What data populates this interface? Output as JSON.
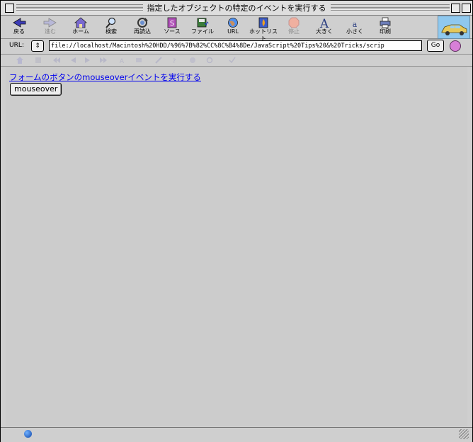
{
  "window": {
    "title": "指定したオブジェクトの特定のイベントを実行する"
  },
  "toolbar": {
    "items": [
      {
        "label": "戻る",
        "icon": "back-arrow-icon",
        "enabled": true
      },
      {
        "label": "進む",
        "icon": "forward-arrow-icon",
        "enabled": false
      },
      {
        "label": "ホーム",
        "icon": "home-icon",
        "enabled": true
      },
      {
        "label": "検索",
        "icon": "search-icon",
        "enabled": true
      },
      {
        "label": "再読込",
        "icon": "reload-icon",
        "enabled": true
      },
      {
        "label": "ソース",
        "icon": "source-icon",
        "enabled": true
      },
      {
        "label": "ファイル",
        "icon": "file-icon",
        "enabled": true
      },
      {
        "label": "URL",
        "icon": "globe-icon",
        "enabled": true
      },
      {
        "label": "ホットリスト",
        "icon": "hotlist-icon",
        "enabled": true
      },
      {
        "label": "停止",
        "icon": "stop-icon",
        "enabled": false
      },
      {
        "label": "大きく",
        "icon": "font-larger-icon",
        "enabled": true
      },
      {
        "label": "小さく",
        "icon": "font-smaller-icon",
        "enabled": true
      },
      {
        "label": "印刷",
        "icon": "print-icon",
        "enabled": true
      }
    ]
  },
  "urlbar": {
    "label": "URL:",
    "url": "file://localhost/Macintosh%20HDD/%96%7B%82%CC%8C%B4%8De/JavaScript%20Tips%20&%20Tricks/scrip",
    "go_label": "Go"
  },
  "content": {
    "link_text": "フォームのボタンのmouseoverイベントを実行する",
    "button_label": "mouseover"
  },
  "colors": {
    "chrome_bg": "#cfcfcf",
    "content_bg": "#cccccc",
    "link": "#0000ee"
  }
}
